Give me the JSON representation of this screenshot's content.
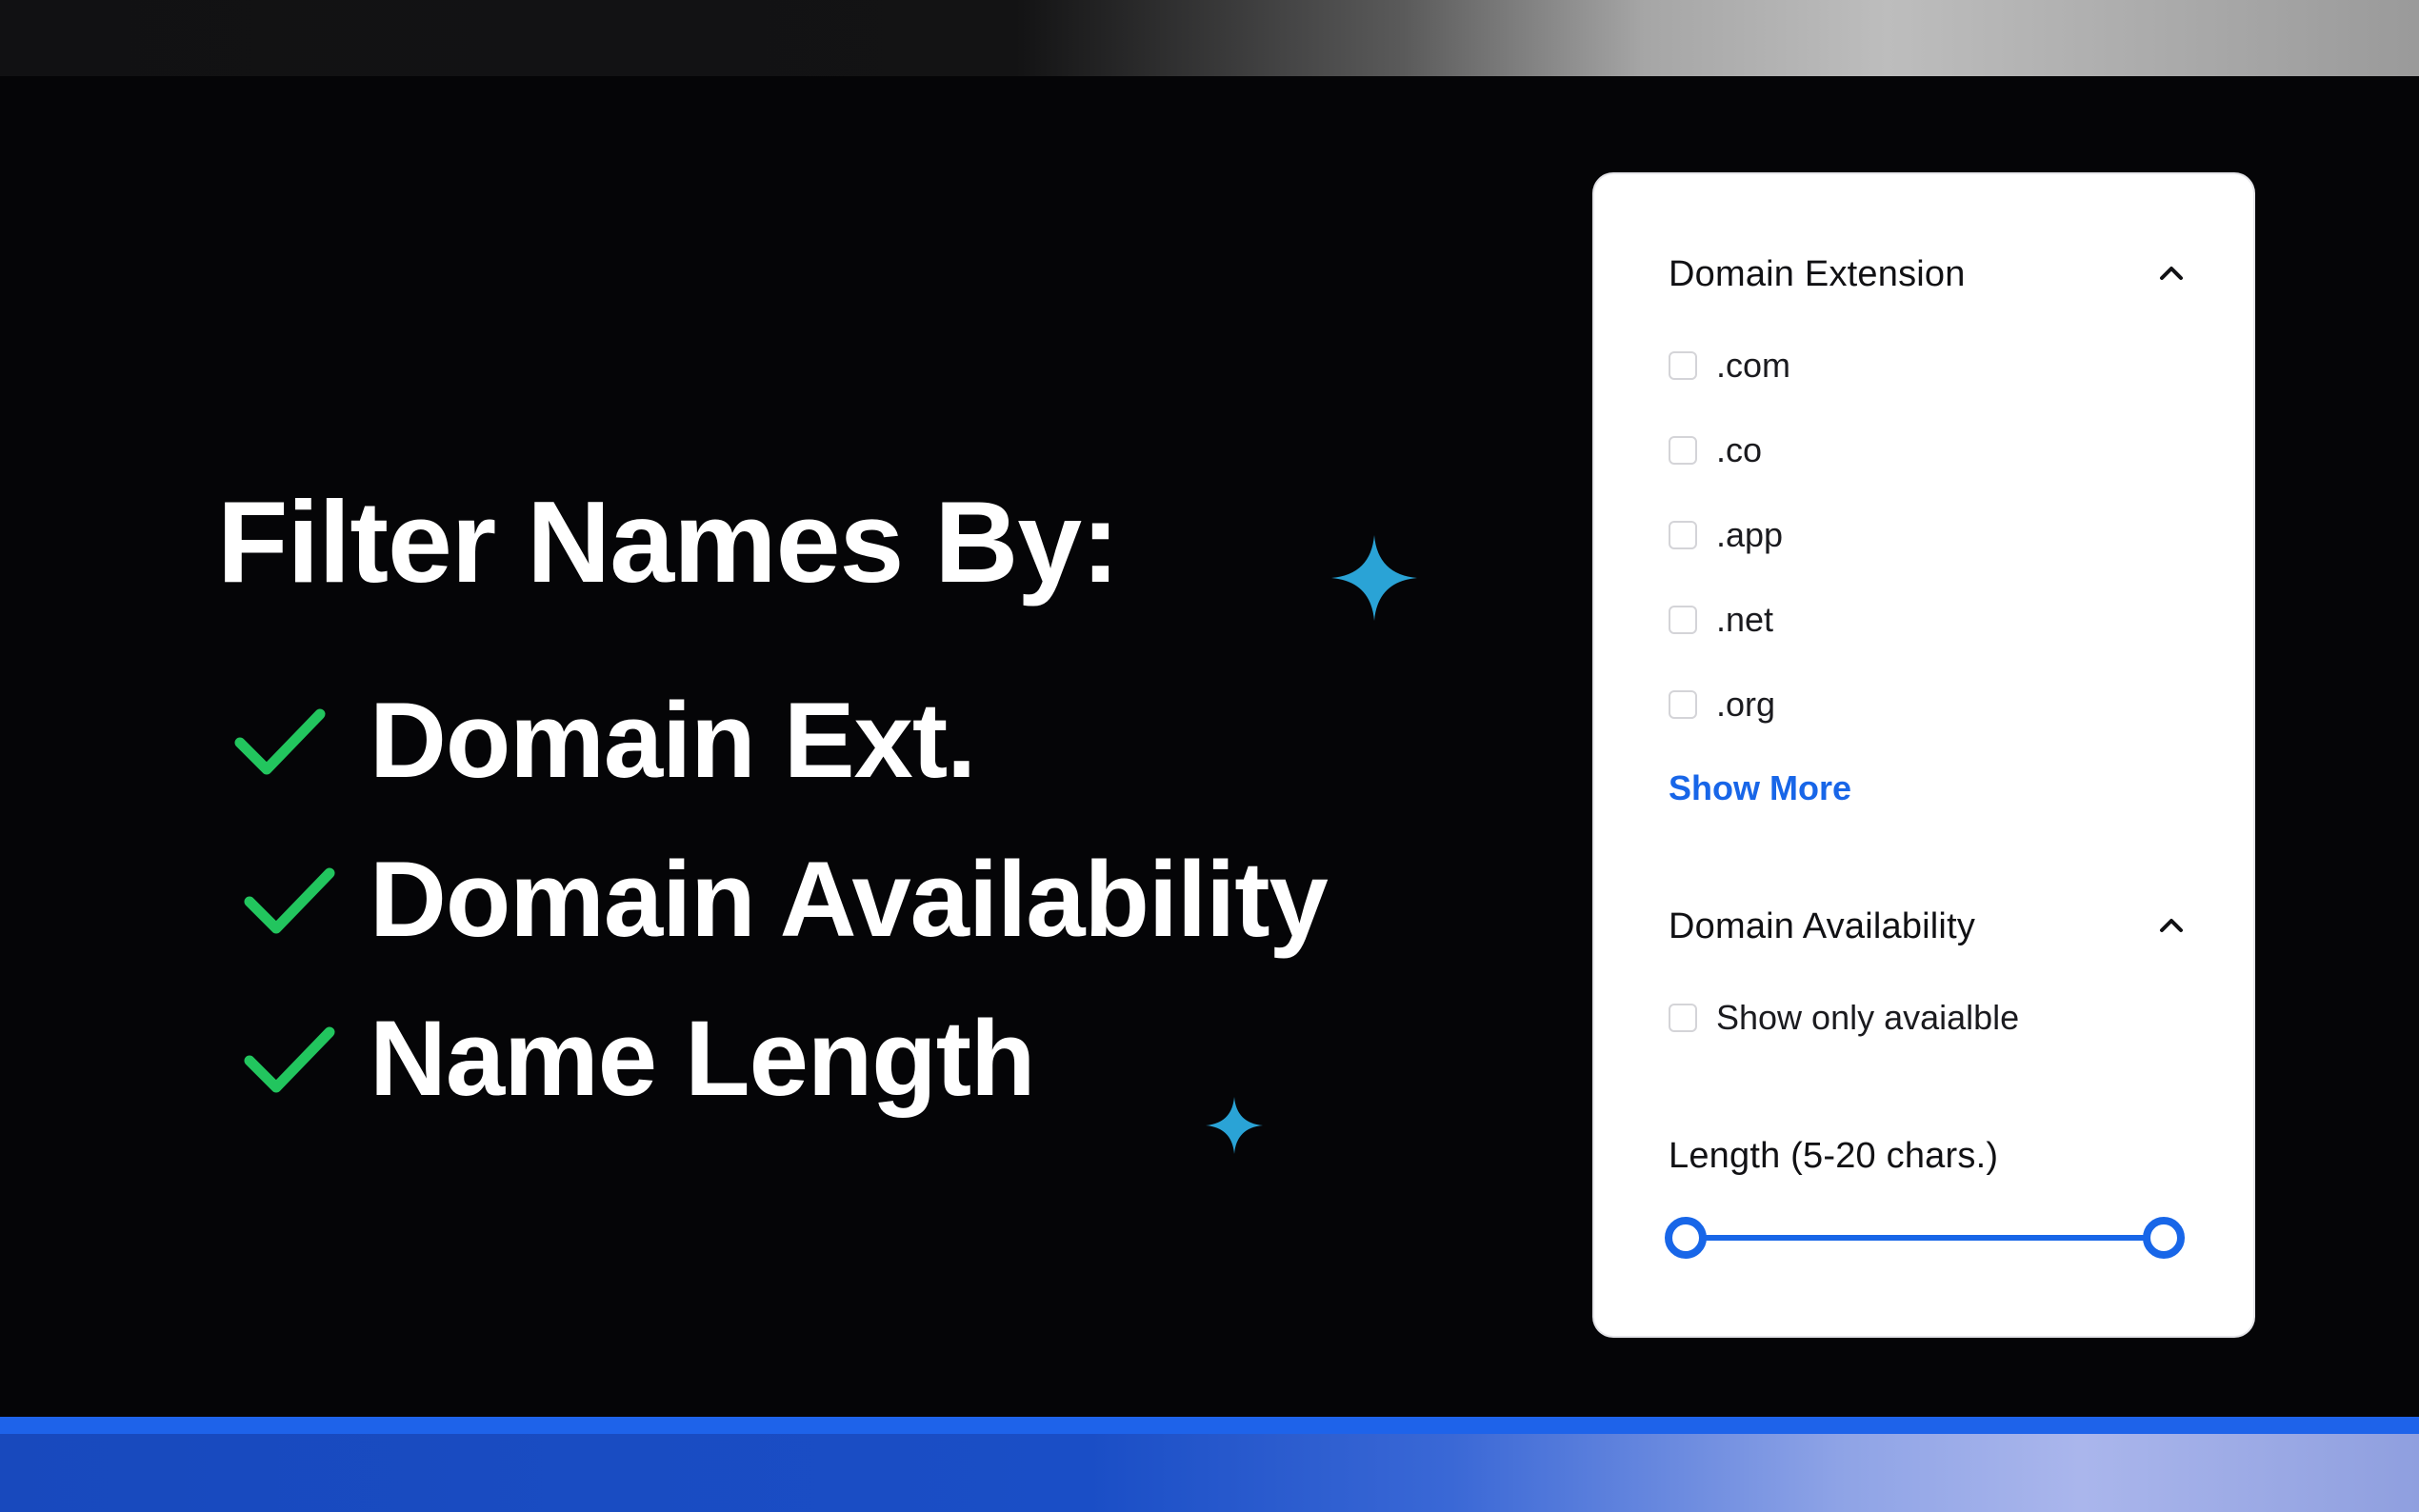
{
  "hero": {
    "headline": "Filter Names By:",
    "features": [
      {
        "label": "Domain Ext.",
        "icon": "check-icon"
      },
      {
        "label": "Domain Availability",
        "icon": "check-icon"
      },
      {
        "label": "Name Length",
        "icon": "check-icon"
      }
    ]
  },
  "filter_panel": {
    "extension": {
      "title": "Domain Extension",
      "options": [
        ".com",
        ".co",
        ".app",
        ".net",
        ".org"
      ],
      "show_more": "Show More"
    },
    "availability": {
      "title": "Domain Availability",
      "option": "Show only avaialble"
    },
    "length": {
      "title": "Length (5-20 chars.)",
      "min": 5,
      "max": 20,
      "selected_min": 5,
      "selected_max": 20
    }
  },
  "colors": {
    "background": "#050507",
    "check": "#22c55e",
    "sparkle": "#2aa3d6",
    "accent": "#1866e8",
    "panel": "#ffffff",
    "stripe": "#1e63ea"
  }
}
